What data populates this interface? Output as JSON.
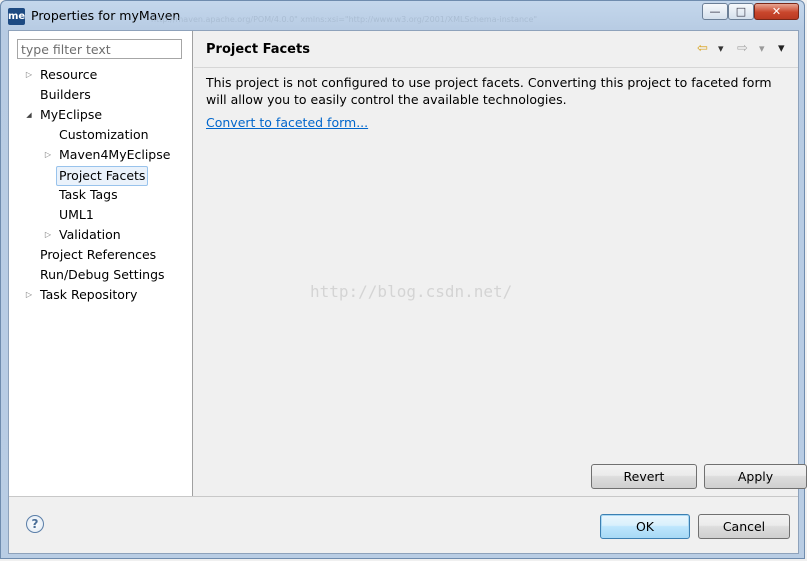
{
  "window": {
    "title": "Properties for myMaven",
    "app_icon_text": "me",
    "controls": {
      "minimize": "—",
      "maximize": "□",
      "close": "✕"
    },
    "behind_text": "http://maven.apache.org/POM/4.0.0\" xmlns:xsi=\"http://www.w3.org/2001/XMLSchema-instance\""
  },
  "filter": {
    "placeholder": "type filter text",
    "value": ""
  },
  "tree": {
    "items": [
      {
        "label": "Resource",
        "expander": "▷"
      },
      {
        "label": "Builders",
        "expander": ""
      },
      {
        "label": "MyEclipse",
        "expander": "◢"
      },
      {
        "label": "Customization",
        "expander": ""
      },
      {
        "label": "Maven4MyEclipse",
        "expander": "▷"
      },
      {
        "label": "Project Facets",
        "expander": ""
      },
      {
        "label": "Task Tags",
        "expander": ""
      },
      {
        "label": "UML1",
        "expander": ""
      },
      {
        "label": "Validation",
        "expander": "▷"
      },
      {
        "label": "Project References",
        "expander": ""
      },
      {
        "label": "Run/Debug Settings",
        "expander": ""
      },
      {
        "label": "Task Repository",
        "expander": "▷"
      }
    ]
  },
  "page": {
    "title": "Project Facets",
    "nav": {
      "back": "⇦",
      "forward": "⇨",
      "dropdown": "▾",
      "menu": "▾"
    },
    "message": "This project is not configured to use project facets. Converting this project to faceted form will allow you to easily control the available technologies.",
    "link": "Convert to faceted form...",
    "watermark": "http://blog.csdn.net/"
  },
  "buttons": {
    "revert": "Revert",
    "apply": "Apply",
    "ok": "OK",
    "cancel": "Cancel",
    "help": "?"
  },
  "colors": {
    "link": "#0066cc",
    "selection_border": "#99c3ec",
    "titlebar": "#b9cde4"
  }
}
